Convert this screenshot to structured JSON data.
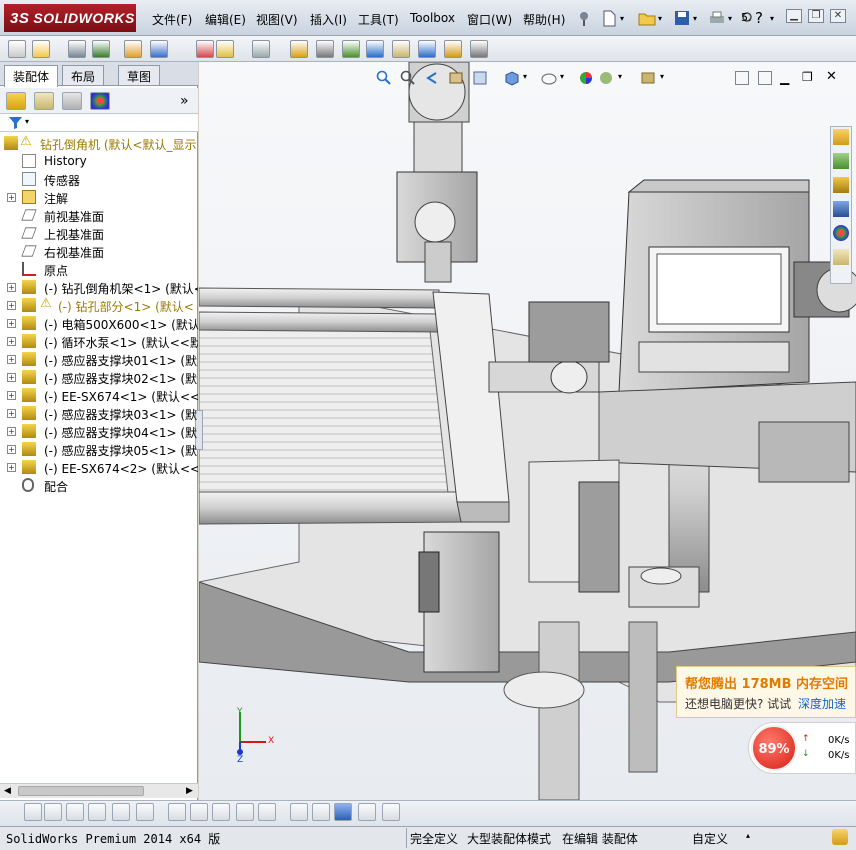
{
  "app": {
    "logo_text": "SOLIDWORKS",
    "logo_prefix": "3S",
    "menu": [
      {
        "label": "文件(F)"
      },
      {
        "label": "编辑(E)"
      },
      {
        "label": "视图(V)"
      },
      {
        "label": "插入(I)"
      },
      {
        "label": "工具(T)"
      },
      {
        "label": "Toolbox"
      },
      {
        "label": "窗口(W)"
      },
      {
        "label": "帮助(H)"
      }
    ],
    "search_short": "5."
  },
  "panel": {
    "tabs": [
      {
        "label": "装配体"
      },
      {
        "label": "布局"
      },
      {
        "label": "草图"
      }
    ],
    "more_arrow": "»"
  },
  "tree": {
    "root": "钻孔倒角机  (默认<默认_显示",
    "items": [
      {
        "label": "History",
        "icon": "history-icon"
      },
      {
        "label": "传感器",
        "icon": "sensor-icon"
      },
      {
        "label": "注解",
        "icon": "annotation-icon"
      },
      {
        "label": "前视基准面",
        "icon": "plane-icon"
      },
      {
        "label": "上视基准面",
        "icon": "plane-icon"
      },
      {
        "label": "右视基准面",
        "icon": "plane-icon"
      },
      {
        "label": "原点",
        "icon": "origin-icon"
      },
      {
        "label": "(-) 钻孔倒角机架<1> (默认<",
        "icon": "part-icon"
      },
      {
        "label": "(-) 钻孔部分<1> (默认<",
        "icon": "warning-part-icon"
      },
      {
        "label": "(-) 电箱500X600<1> (默认<",
        "icon": "part-icon"
      },
      {
        "label": "(-) 循环水泵<1> (默认<<默",
        "icon": "part-icon"
      },
      {
        "label": "(-) 感应器支撑块01<1> (默",
        "icon": "part-icon"
      },
      {
        "label": "(-) 感应器支撑块02<1> (默",
        "icon": "part-icon"
      },
      {
        "label": "(-) EE-SX674<1> (默认<<默",
        "icon": "part-icon"
      },
      {
        "label": "(-) 感应器支撑块03<1> (默",
        "icon": "part-icon"
      },
      {
        "label": "(-) 感应器支撑块04<1> (默",
        "icon": "part-icon"
      },
      {
        "label": "(-) 感应器支撑块05<1> (默",
        "icon": "part-icon"
      },
      {
        "label": "(-) EE-SX674<2> (默认<<默",
        "icon": "part-icon"
      },
      {
        "label": "配合",
        "icon": "mates-icon"
      }
    ]
  },
  "triad": {
    "x": "X",
    "y": "Y",
    "z": "Z"
  },
  "popup": {
    "title": "帮您腾出 178MB 内存空间",
    "sub": "还想电脑更快? 试试",
    "link": "深度加速"
  },
  "speed": {
    "percent": "89%",
    "up": "0K/s",
    "down": "0K/s"
  },
  "status": {
    "version": "SolidWorks Premium 2014 x64 版",
    "fully_defined": "完全定义",
    "large_mode": "大型装配体模式",
    "editing": "在编辑 装配体",
    "custom": "自定义"
  },
  "colors": {
    "accent_red": "#b3202a",
    "viewport_bg": "#eef0f4",
    "popup_title": "#e07b00",
    "popup_link": "#1e5bd6"
  }
}
